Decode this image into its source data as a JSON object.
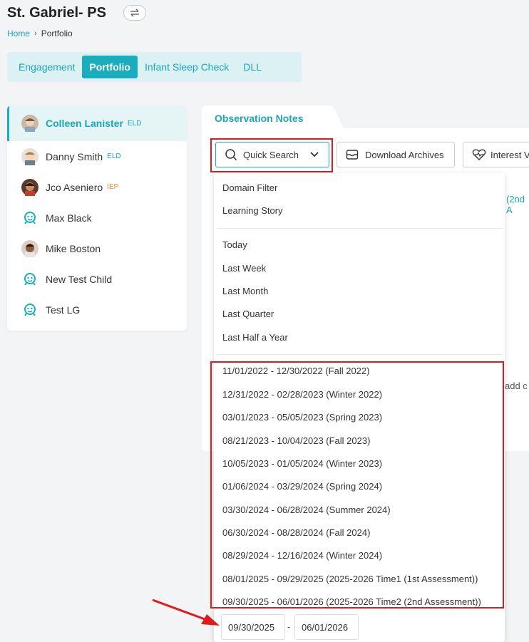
{
  "header": {
    "site_title": "St. Gabriel- PS"
  },
  "breadcrumb": {
    "home": "Home",
    "current": "Portfolio"
  },
  "tabs": [
    "Engagement",
    "Portfolio",
    "Infant Sleep Check",
    "DLL"
  ],
  "children": [
    {
      "name": "Colleen Lanister",
      "badge": "ELD"
    },
    {
      "name": "Danny Smith",
      "badge": "ELD"
    },
    {
      "name": "Jco Aseniero",
      "badge": "IEP"
    },
    {
      "name": "Max Black",
      "badge": ""
    },
    {
      "name": "Mike Boston",
      "badge": ""
    },
    {
      "name": "New Test Child",
      "badge": ""
    },
    {
      "name": "Test LG",
      "badge": ""
    }
  ],
  "observation": {
    "tab_label": "Observation Notes",
    "quick_search_label": "Quick Search",
    "download_label": "Download Archives",
    "interest_label": "Interest V",
    "behind_text_1": "(2nd A",
    "behind_text_2": "add c"
  },
  "dropdown": {
    "filters": [
      "Domain Filter",
      "Learning Story"
    ],
    "periods": [
      "Today",
      "Last Week",
      "Last Month",
      "Last Quarter",
      "Last Half a Year"
    ],
    "ranges": [
      "11/01/2022 - 12/30/2022 (Fall 2022)",
      "12/31/2022 - 02/28/2023 (Winter 2022)",
      "03/01/2023 - 05/05/2023 (Spring 2023)",
      "08/21/2023 - 10/04/2023 (Fall 2023)",
      "10/05/2023 - 01/05/2024 (Winter 2023)",
      "01/06/2024 - 03/29/2024 (Spring 2024)",
      "03/30/2024 - 06/28/2024 (Summer 2024)",
      "06/30/2024 - 08/28/2024 (Fall 2024)",
      "08/29/2024 - 12/16/2024 (Winter 2024)",
      "08/01/2025 - 09/29/2025 (2025-2026 Time1 (1st Assessment))",
      "09/30/2025 - 06/01/2026 (2025-2026 Time2 (2nd Assessment))"
    ]
  },
  "date_range": {
    "start": "09/30/2025",
    "separator": "-",
    "end": "06/01/2026"
  },
  "colors": {
    "accent": "#1aadbd",
    "highlight": "#e01b1b",
    "iep": "#e08a2a"
  }
}
